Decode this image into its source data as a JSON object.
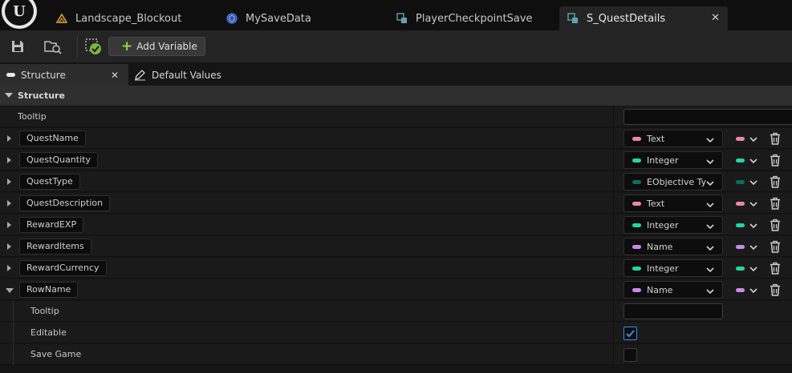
{
  "tabs": [
    {
      "label": "Landscape_Blockout",
      "icon": "level-icon",
      "color": "#e0a13a"
    },
    {
      "label": "MySaveData",
      "icon": "blueprint-icon",
      "color": "#4f7fe6"
    },
    {
      "label": "PlayerCheckpointSave",
      "icon": "save-game-icon",
      "color": "#5fa3b3"
    },
    {
      "label": "S_QuestDetails",
      "icon": "struct-icon",
      "color": "#5fa3b3",
      "active": true
    }
  ],
  "toolbar": {
    "save_icon": "save-icon",
    "browse_icon": "browse-icon",
    "checkout_icon": "source-control-icon",
    "add_variable_label": "Add Variable"
  },
  "panel_tabs": [
    {
      "label": "Structure",
      "active": true
    },
    {
      "label": "Default Values",
      "icon": "edit-icon"
    }
  ],
  "section": {
    "title": "Structure"
  },
  "tooltip_label": "Tooltip",
  "members": [
    {
      "name": "QuestName",
      "type": "Text",
      "pin_color": "#e88aa6"
    },
    {
      "name": "QuestQuantity",
      "type": "Integer",
      "pin_color": "#1fd8a4"
    },
    {
      "name": "QuestType",
      "type": "EObjective Ty",
      "pin_color": "#0e6b63"
    },
    {
      "name": "QuestDescription",
      "type": "Text",
      "pin_color": "#e88aa6"
    },
    {
      "name": "RewardEXP",
      "type": "Integer",
      "pin_color": "#1fd8a4"
    },
    {
      "name": "RewardItems",
      "type": "Name",
      "pin_color": "#c98ae8"
    },
    {
      "name": "RewardCurrency",
      "type": "Integer",
      "pin_color": "#1fd8a4"
    },
    {
      "name": "RowName",
      "type": "Name",
      "pin_color": "#c98ae8",
      "expanded": true
    }
  ],
  "rowname_details": {
    "tooltip_label": "Tooltip",
    "editable_label": "Editable",
    "editable_checked": true,
    "savegame_label": "Save Game",
    "savegame_checked": false
  }
}
